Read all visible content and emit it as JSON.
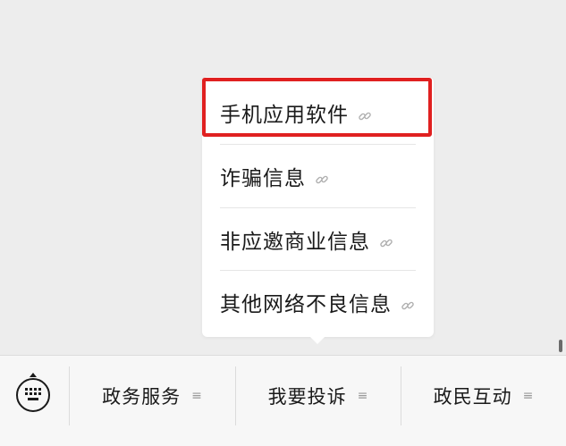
{
  "popup_menu": {
    "items": [
      {
        "label": "手机应用软件",
        "icon": "link-icon"
      },
      {
        "label": "诈骗信息",
        "icon": "link-icon"
      },
      {
        "label": "非应邀商业信息",
        "icon": "link-icon"
      },
      {
        "label": "其他网络不良信息",
        "icon": "link-icon"
      }
    ]
  },
  "bottom_bar": {
    "keyboard_icon": "keyboard-icon",
    "menu_icon_glyph": "≡",
    "tabs": [
      {
        "label": "政务服务"
      },
      {
        "label": "我要投诉"
      },
      {
        "label": "政民互动"
      }
    ]
  },
  "colors": {
    "highlight": "#e02020",
    "background": "#ededed",
    "popup": "#ffffff"
  }
}
